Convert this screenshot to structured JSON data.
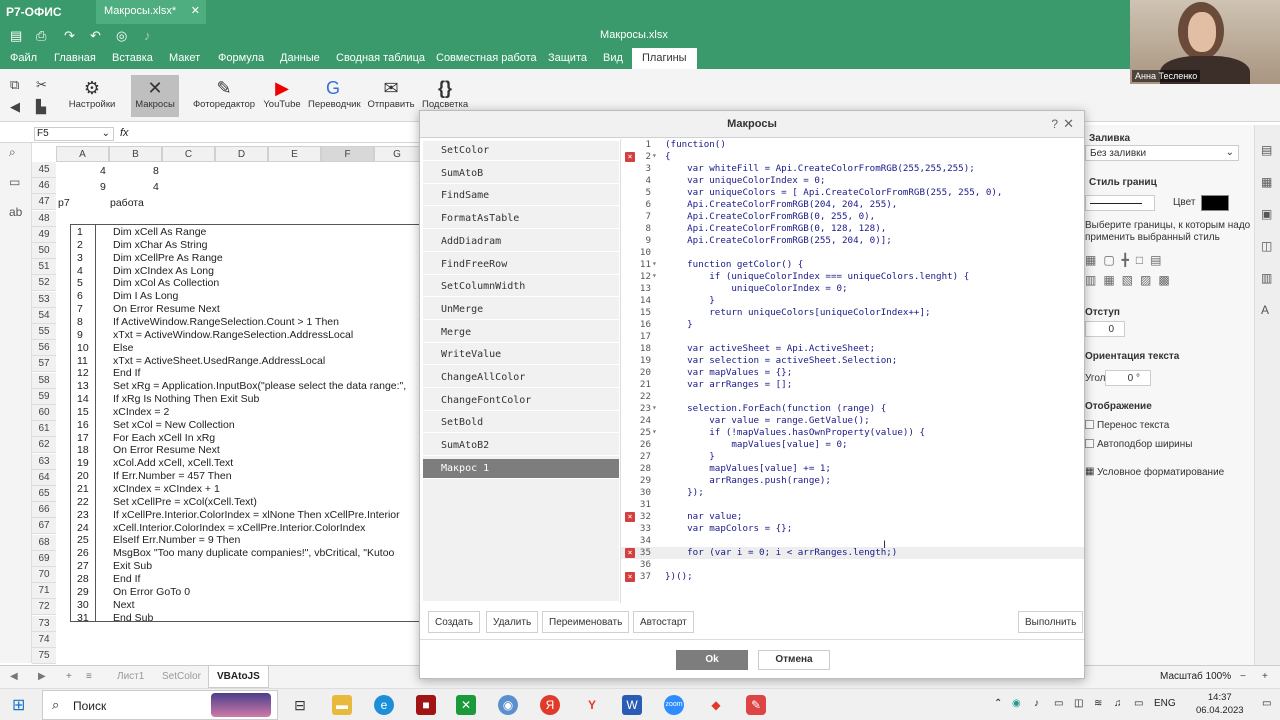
{
  "app": {
    "logo": "Р7-ОФИС",
    "doc_tab": "Макросы.xlsx*",
    "file_name": "Макросы.xlsx"
  },
  "menu": [
    "Файл",
    "Главная",
    "Вставка",
    "Макет",
    "Формула",
    "Данные",
    "Сводная таблица",
    "Совместная работа",
    "Защита",
    "Вид",
    "Плагины"
  ],
  "ribbon": {
    "settings": "Настройки",
    "macros": "Макросы",
    "photo": "Фоторедактор",
    "youtube": "YouTube",
    "translator": "Переводчик",
    "send": "Отправить",
    "highlight": "Подсветка"
  },
  "formula_bar": {
    "cell_ref": "F5",
    "fx": "fx"
  },
  "columns": [
    "A",
    "B",
    "C",
    "D",
    "E",
    "F",
    "G"
  ],
  "rows": [
    "45",
    "46",
    "47",
    "48",
    "49",
    "50",
    "51",
    "52",
    "53",
    "54",
    "55",
    "56",
    "57",
    "58",
    "59",
    "60",
    "61",
    "62",
    "63",
    "64",
    "65",
    "66",
    "67",
    "68",
    "69",
    "70",
    "71",
    "72",
    "73",
    "74",
    "75"
  ],
  "cells": {
    "a45": "4",
    "b45": "8",
    "a46": "9",
    "b46": "4",
    "a47": "p7",
    "b47": "работа"
  },
  "vba_lines": [
    [
      "1",
      "Dim xCell As Range"
    ],
    [
      "2",
      "Dim xChar As String"
    ],
    [
      "3",
      "Dim xCellPre As Range"
    ],
    [
      "4",
      "Dim xCIndex As Long"
    ],
    [
      "5",
      "Dim xCol As Collection"
    ],
    [
      "6",
      "Dim I As Long"
    ],
    [
      "7",
      "On Error Resume Next"
    ],
    [
      "8",
      "If ActiveWindow.RangeSelection.Count > 1 Then"
    ],
    [
      "9",
      "  xTxt = ActiveWindow.RangeSelection.AddressLocal"
    ],
    [
      "10",
      "Else"
    ],
    [
      "11",
      "  xTxt = ActiveSheet.UsedRange.AddressLocal"
    ],
    [
      "12",
      "End If"
    ],
    [
      "13",
      "Set xRg = Application.InputBox(\"please select the data range:\","
    ],
    [
      "14",
      "If xRg Is Nothing Then Exit Sub"
    ],
    [
      "15",
      "xCIndex = 2"
    ],
    [
      "16",
      "Set xCol = New Collection"
    ],
    [
      "17",
      "For Each xCell In xRg"
    ],
    [
      "18",
      "  On Error Resume Next"
    ],
    [
      "19",
      "  xCol.Add xCell, xCell.Text"
    ],
    [
      "20",
      "  If Err.Number = 457 Then"
    ],
    [
      "21",
      "    xCIndex = xCIndex + 1"
    ],
    [
      "22",
      "    Set xCellPre = xCol(xCell.Text)"
    ],
    [
      "23",
      "    If xCellPre.Interior.ColorIndex = xlNone Then xCellPre.Interior"
    ],
    [
      "24",
      "    xCell.Interior.ColorIndex = xCellPre.Interior.ColorIndex"
    ],
    [
      "25",
      "  ElseIf Err.Number = 9 Then"
    ],
    [
      "26",
      "    MsgBox \"Too many duplicate companies!\", vbCritical, \"Kutoo"
    ],
    [
      "27",
      "    Exit Sub"
    ],
    [
      "28",
      "  End If"
    ],
    [
      "29",
      "  On Error GoTo 0"
    ],
    [
      "30",
      "  Next"
    ],
    [
      "31",
      "End Sub"
    ]
  ],
  "sheet_tabs": {
    "t1": "Лист1",
    "t2": "SetColor",
    "t3": "VBAtoJS"
  },
  "right_panel": {
    "fill": "Заливка",
    "no_fill": "Без заливки",
    "border_style": "Стиль границ",
    "color": "Цвет",
    "border_hint1": "Выберите границы, к которым надо",
    "border_hint2": "применить выбранный стиль",
    "indent": "Отступ",
    "indent_val": "0",
    "orientation": "Ориентация текста",
    "orient_label": "Угол",
    "orient_val": "0 °",
    "display": "Отображение",
    "wrap": "Перенос текста",
    "autofit": "Автоподбор ширины",
    "cond": "Условное форматирование",
    "zoom": "Масштаб 100%"
  },
  "webcam": {
    "name": "Анна Тесленко"
  },
  "dialog": {
    "title": "Макросы",
    "help": "?",
    "macros": [
      "SetColor",
      "SumAtoB",
      "FindSame",
      "FormatAsTable",
      "AddDiadram",
      "FindFreeRow",
      "SetColumnWidth",
      "UnMerge",
      "Merge",
      "WriteValue",
      "ChangeAllColor",
      "ChangeFontColor",
      "SetBold",
      "SumAtoB2",
      "Макрос 1"
    ],
    "code": [
      {
        "n": "1",
        "t": "(function()",
        "e": false,
        "f": false
      },
      {
        "n": "2",
        "t": "{",
        "e": true,
        "f": true
      },
      {
        "n": "3",
        "t": "    var whiteFill = Api.CreateColorFromRGB(255,255,255);",
        "e": false,
        "f": false
      },
      {
        "n": "4",
        "t": "    var uniqueColorIndex = 0;",
        "e": false,
        "f": false
      },
      {
        "n": "5",
        "t": "    var uniqueColors = [ Api.CreateColorFromRGB(255, 255, 0),",
        "e": false,
        "f": false
      },
      {
        "n": "6",
        "t": "    Api.CreateColorFromRGB(204, 204, 255),",
        "e": false,
        "f": false
      },
      {
        "n": "7",
        "t": "    Api.CreateColorFromRGB(0, 255, 0),",
        "e": false,
        "f": false
      },
      {
        "n": "8",
        "t": "    Api.CreateColorFromRGB(0, 128, 128),",
        "e": false,
        "f": false
      },
      {
        "n": "9",
        "t": "    Api.CreateColorFromRGB(255, 204, 0)];",
        "e": false,
        "f": false
      },
      {
        "n": "10",
        "t": "",
        "e": false,
        "f": false
      },
      {
        "n": "11",
        "t": "    function getColor() {",
        "e": false,
        "f": true
      },
      {
        "n": "12",
        "t": "        if (uniqueColorIndex === uniqueColors.lenght) {",
        "e": false,
        "f": true
      },
      {
        "n": "13",
        "t": "            uniqueColorIndex = 0;",
        "e": false,
        "f": false
      },
      {
        "n": "14",
        "t": "        }",
        "e": false,
        "f": false
      },
      {
        "n": "15",
        "t": "        return uniqueColors[uniqueColorIndex++];",
        "e": false,
        "f": false
      },
      {
        "n": "16",
        "t": "    }",
        "e": false,
        "f": false
      },
      {
        "n": "17",
        "t": "",
        "e": false,
        "f": false
      },
      {
        "n": "18",
        "t": "    var activeSheet = Api.ActiveSheet;",
        "e": false,
        "f": false
      },
      {
        "n": "19",
        "t": "    var selection = activeSheet.Selection;",
        "e": false,
        "f": false
      },
      {
        "n": "20",
        "t": "    var mapValues = {};",
        "e": false,
        "f": false
      },
      {
        "n": "21",
        "t": "    var arrRanges = [];",
        "e": false,
        "f": false
      },
      {
        "n": "22",
        "t": "",
        "e": false,
        "f": false
      },
      {
        "n": "23",
        "t": "    selection.ForEach(function (range) {",
        "e": false,
        "f": true
      },
      {
        "n": "24",
        "t": "        var value = range.GetValue();",
        "e": false,
        "f": false
      },
      {
        "n": "25",
        "t": "        if (!mapValues.hasOwnProperty(value)) {",
        "e": false,
        "f": true
      },
      {
        "n": "26",
        "t": "            mapValues[value] = 0;",
        "e": false,
        "f": false
      },
      {
        "n": "27",
        "t": "        }",
        "e": false,
        "f": false
      },
      {
        "n": "28",
        "t": "        mapValues[value] += 1;",
        "e": false,
        "f": false
      },
      {
        "n": "29",
        "t": "        arrRanges.push(range);",
        "e": false,
        "f": false
      },
      {
        "n": "30",
        "t": "    });",
        "e": false,
        "f": false
      },
      {
        "n": "31",
        "t": "",
        "e": false,
        "f": false
      },
      {
        "n": "32",
        "t": "    nar value;",
        "e": true,
        "f": false
      },
      {
        "n": "33",
        "t": "    var mapColors = {};",
        "e": false,
        "f": false
      },
      {
        "n": "34",
        "t": "",
        "e": false,
        "f": false
      },
      {
        "n": "35",
        "t": "    for (var i = 0; i < arrRanges.length;)",
        "e": true,
        "f": false
      },
      {
        "n": "36",
        "t": "",
        "e": false,
        "f": false
      },
      {
        "n": "37",
        "t": "})();",
        "e": true,
        "f": false
      }
    ],
    "buttons": {
      "create": "Создать",
      "delete": "Удалить",
      "rename": "Переименовать",
      "autostart": "Автостарт",
      "run": "Выполнить",
      "ok": "Ok",
      "cancel": "Отмена"
    }
  },
  "taskbar": {
    "search": "Поиск",
    "lang": "ENG",
    "time": "14:37",
    "date": "06.04.2023"
  }
}
